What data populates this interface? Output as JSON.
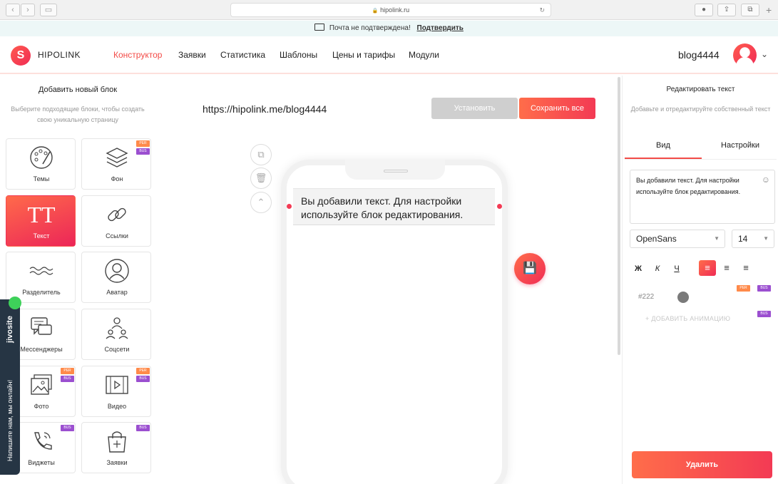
{
  "browser": {
    "url": "hipolink.ru",
    "back": "‹",
    "forward": "›",
    "sidebar_icon": "▭",
    "reload": "↻",
    "lock": "🔒",
    "ext1": "●",
    "share": "⇪",
    "tabs": "⧉",
    "new_tab": "+"
  },
  "notice": {
    "text": "Почта не подтверждена!",
    "link": "Подтвердить",
    "icon": "envelope-icon"
  },
  "header": {
    "logo_text": "HIPOLINK",
    "logo_mark": "S",
    "nav": [
      "Конструктор",
      "Заявки",
      "Статистика",
      "Шаблоны",
      "Цены и тарифы",
      "Модули"
    ],
    "active_index": 0,
    "username": "blog4444",
    "caret": "⌄"
  },
  "left_panel": {
    "title": "Добавить новый блок",
    "subtitle": "Выберите подходящие блоки, чтобы создать свою уникальную страницу",
    "tiles": [
      {
        "label": "Темы",
        "icon": "palette-icon",
        "badges": []
      },
      {
        "label": "Фон",
        "icon": "layers-icon",
        "badges": [
          "PER",
          "BUS"
        ]
      },
      {
        "label": "Текст",
        "icon": "text-icon",
        "glyph": "TT",
        "badges": []
      },
      {
        "label": "Ссылки",
        "icon": "link-icon",
        "badges": []
      },
      {
        "label": "Разделитель",
        "icon": "wave-divider-icon",
        "badges": []
      },
      {
        "label": "Аватар",
        "icon": "avatar-icon",
        "badges": []
      },
      {
        "label": "Мессенджеры",
        "icon": "chat-icon",
        "badges": []
      },
      {
        "label": "Соцсети",
        "icon": "social-icon",
        "badges": []
      },
      {
        "label": "Фото",
        "icon": "photo-icon",
        "badges": [
          "PER",
          "BUS"
        ]
      },
      {
        "label": "Видео",
        "icon": "video-icon",
        "badges": [
          "PER",
          "BUS"
        ]
      },
      {
        "label": "Виджеты",
        "icon": "phone-icon",
        "badges": [
          "BUS"
        ]
      },
      {
        "label": "Заявки",
        "icon": "bag-icon",
        "badges": [
          "BUS"
        ]
      }
    ]
  },
  "jivo": {
    "brand": "jivosite",
    "text": "Напишите нам, мы онлайн!"
  },
  "center": {
    "site_url": "https://hipolink.me/blog4444",
    "install_label": "Установить",
    "save_all_label": "Сохранить все",
    "phone_text": "Вы добавили текст. Для настройки используйте блок редактирования.",
    "tool_copy": "⧉",
    "tool_delete": "🗑",
    "tool_up": "⌃",
    "save_fab": "💾"
  },
  "right_panel": {
    "title": "Редактировать текст",
    "subtitle": "Добавьте и отредактируйте собственный текст",
    "tabs": [
      "Вид",
      "Настройки"
    ],
    "active_tab": 0,
    "text_value": "Вы добавили текст. Для настройки используйте блок редактирования.",
    "emoji": "☺",
    "font": "OpenSans",
    "size": "14",
    "bold": "Ж",
    "italic": "К",
    "underline": "Ч",
    "align_left": "≡",
    "align_center": "≡",
    "align_right": "≡",
    "color_code": "#222",
    "add_animation": "+ ДОБАВИТЬ АНИМАЦИЮ",
    "delete_label": "Удалить",
    "badge_per": "PER",
    "badge_bus": "BUS"
  },
  "colors": {
    "accent": "#f34b47",
    "gradient_start": "#ff6d4a",
    "gradient_end": "#f02c55",
    "badge_per": "#ff8a4a",
    "badge_bus": "#9b4fd0",
    "jivo_bg": "#263544"
  }
}
